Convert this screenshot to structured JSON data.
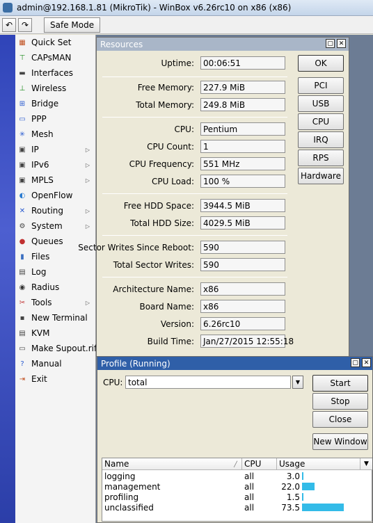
{
  "window_title": "admin@192.168.1.81 (MikroTik) - WinBox v6.26rc10 on x86 (x86)",
  "toolbar": {
    "undo_icon": "undo-icon",
    "redo_icon": "redo-icon",
    "safe_mode_label": "Safe Mode"
  },
  "menu": {
    "items": [
      {
        "label": "Quick Set",
        "icon": "quick-set-icon"
      },
      {
        "label": "CAPsMAN",
        "icon": "capsman-icon"
      },
      {
        "label": "Interfaces",
        "icon": "interfaces-icon"
      },
      {
        "label": "Wireless",
        "icon": "wireless-icon"
      },
      {
        "label": "Bridge",
        "icon": "bridge-icon"
      },
      {
        "label": "PPP",
        "icon": "ppp-icon"
      },
      {
        "label": "Mesh",
        "icon": "mesh-icon"
      },
      {
        "label": "IP",
        "icon": "ip-icon",
        "submenu": true
      },
      {
        "label": "IPv6",
        "icon": "ipv6-icon",
        "submenu": true
      },
      {
        "label": "MPLS",
        "icon": "mpls-icon",
        "submenu": true
      },
      {
        "label": "OpenFlow",
        "icon": "openflow-icon"
      },
      {
        "label": "Routing",
        "icon": "routing-icon",
        "submenu": true
      },
      {
        "label": "System",
        "icon": "system-icon",
        "submenu": true
      },
      {
        "label": "Queues",
        "icon": "queues-icon"
      },
      {
        "label": "Files",
        "icon": "files-icon"
      },
      {
        "label": "Log",
        "icon": "log-icon"
      },
      {
        "label": "Radius",
        "icon": "radius-icon"
      },
      {
        "label": "Tools",
        "icon": "tools-icon",
        "submenu": true
      },
      {
        "label": "New Terminal",
        "icon": "terminal-icon"
      },
      {
        "label": "KVM",
        "icon": "kvm-icon"
      },
      {
        "label": "Make Supout.rif",
        "icon": "supout-icon"
      },
      {
        "label": "Manual",
        "icon": "manual-icon"
      },
      {
        "label": "Exit",
        "icon": "exit-icon"
      }
    ]
  },
  "resources": {
    "title": "Resources",
    "fields": {
      "uptime_label": "Uptime:",
      "uptime": "00:06:51",
      "free_memory_label": "Free Memory:",
      "free_memory": "227.9 MiB",
      "total_memory_label": "Total Memory:",
      "total_memory": "249.8 MiB",
      "cpu_label": "CPU:",
      "cpu": "Pentium",
      "cpu_count_label": "CPU Count:",
      "cpu_count": "1",
      "cpu_frequency_label": "CPU Frequency:",
      "cpu_frequency": "551 MHz",
      "cpu_load_label": "CPU Load:",
      "cpu_load": "100 %",
      "free_hdd_label": "Free HDD Space:",
      "free_hdd": "3944.5 MiB",
      "total_hdd_label": "Total HDD Size:",
      "total_hdd": "4029.5 MiB",
      "sector_writes_reboot_label": "Sector Writes Since Reboot:",
      "sector_writes_reboot": "590",
      "total_sector_writes_label": "Total Sector Writes:",
      "total_sector_writes": "590",
      "architecture_label": "Architecture Name:",
      "architecture": "x86",
      "board_label": "Board Name:",
      "board": "x86",
      "version_label": "Version:",
      "version": "6.26rc10",
      "build_time_label": "Build Time:",
      "build_time": "Jan/27/2015 12:55:18"
    },
    "buttons": {
      "ok": "OK",
      "pci": "PCI",
      "usb": "USB",
      "cpu": "CPU",
      "irq": "IRQ",
      "rps": "RPS",
      "hardware": "Hardware"
    }
  },
  "profile": {
    "title": "Profile (Running)",
    "cpu_label": "CPU:",
    "cpu_value": "total",
    "buttons": {
      "start": "Start",
      "stop": "Stop",
      "close": "Close",
      "new_window": "New Window"
    },
    "columns": {
      "name": "Name",
      "cpu": "CPU",
      "usage": "Usage"
    },
    "rows": [
      {
        "name": "logging",
        "cpu": "all",
        "usage": "3.0",
        "usage_value": 3.0
      },
      {
        "name": "management",
        "cpu": "all",
        "usage": "22.0",
        "usage_value": 22.0
      },
      {
        "name": "profiling",
        "cpu": "all",
        "usage": "1.5",
        "usage_value": 1.5
      },
      {
        "name": "unclassified",
        "cpu": "all",
        "usage": "73.5",
        "usage_value": 73.5
      }
    ]
  },
  "colors": {
    "accent_bar": "#33bbe8",
    "menu_strip": "#3b4fc0",
    "window_title_inactive": "#a9b6c8",
    "window_title_active": "#2f5fa8"
  }
}
